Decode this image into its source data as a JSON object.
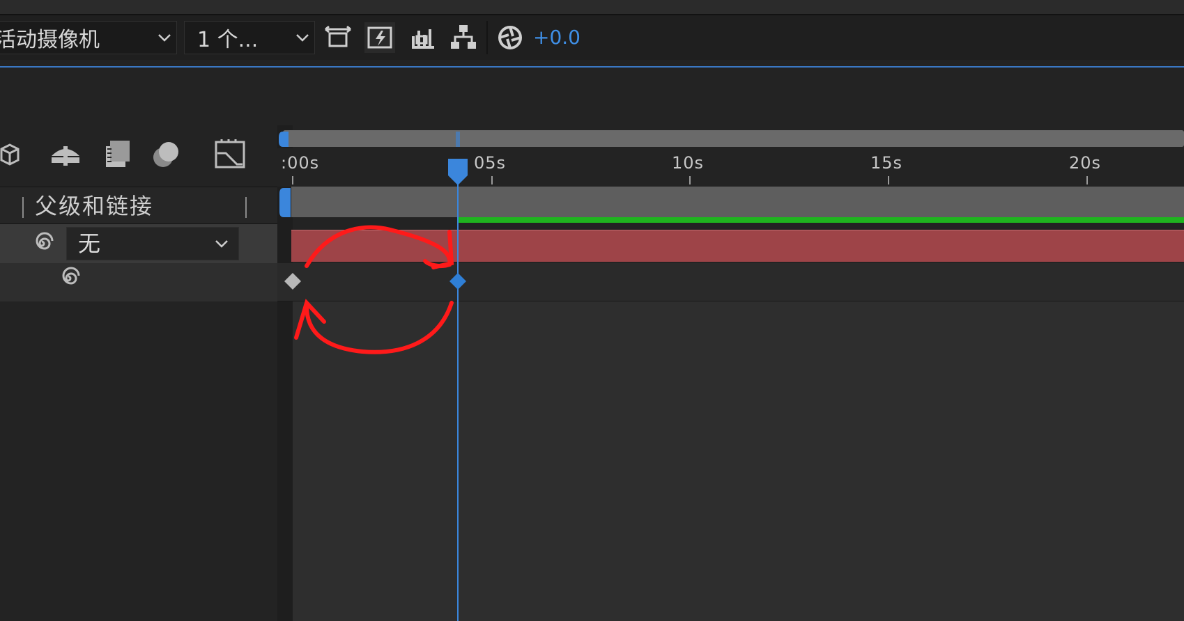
{
  "toolbar": {
    "camera_dropdown_label": "活动摄像机",
    "view_dropdown_label": "1 个...",
    "exposure_value": "+0.0"
  },
  "columns": {
    "parent_link_header": "父级和链接"
  },
  "layer": {
    "parent_value": "无"
  },
  "ruler": {
    "labels": [
      ":00s",
      "05s",
      "10s",
      "15s",
      "20s"
    ]
  },
  "colors": {
    "accent": "#3b86dc",
    "layer_bar": "#9e4448",
    "work_area": "#1fb41f",
    "annotation": "#ff1a1a"
  }
}
